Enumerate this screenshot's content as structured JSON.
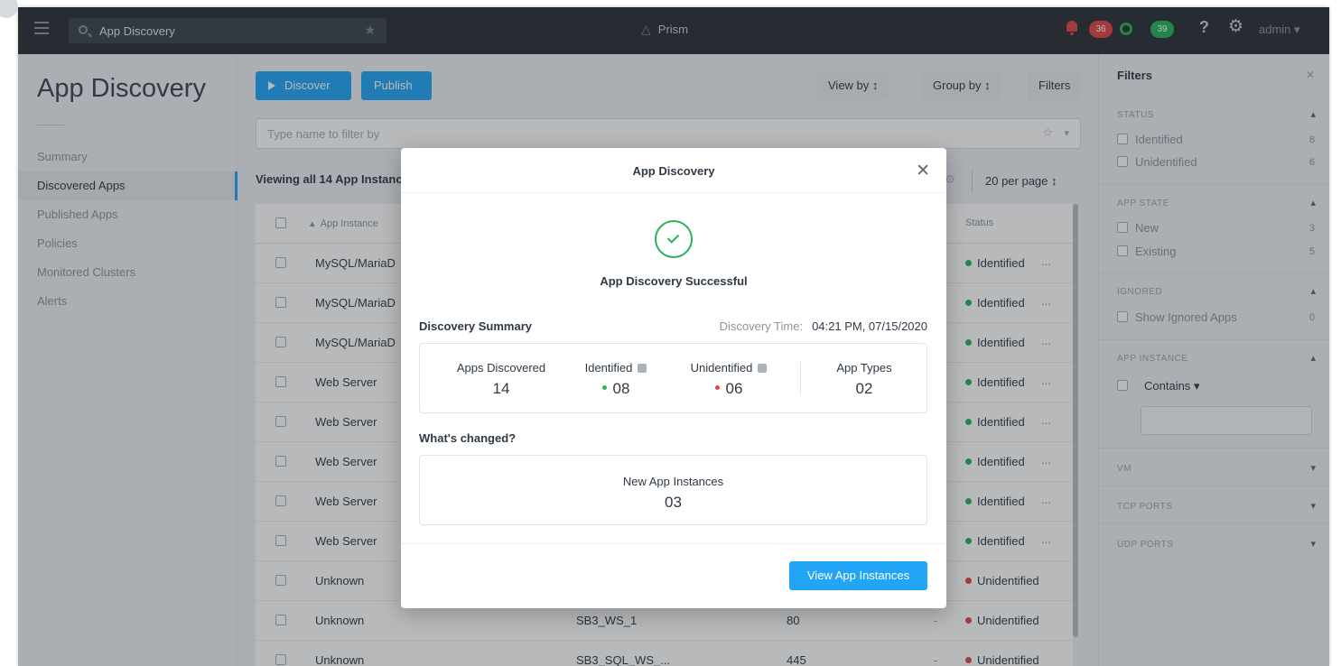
{
  "topbar": {
    "search_text": "App Discovery",
    "brand": "Prism",
    "alerts_count": "36",
    "tasks_count": "39",
    "help_label": "?",
    "user": "admin"
  },
  "leftnav": {
    "title": "App Discovery",
    "items": [
      "Summary",
      "Discovered Apps",
      "Published Apps",
      "Policies",
      "Monitored Clusters",
      "Alerts"
    ]
  },
  "toolbar": {
    "discover_label": "Discover",
    "publish_label": "Publish",
    "view_by": "View by",
    "group_by": "Group by",
    "filters": "Filters",
    "filter_placeholder": "Type name to filter by",
    "viewing": "Viewing all 14 App Instanc",
    "per_page": "20 per page"
  },
  "table": {
    "headers": {
      "app_instance": "App Instance",
      "status": "Status"
    },
    "rows": [
      {
        "name": "MySQL/MariaD",
        "vm": "",
        "port": "",
        "dash": "",
        "status": "Identified",
        "more": "..."
      },
      {
        "name": "MySQL/MariaD",
        "vm": "",
        "port": "",
        "dash": "",
        "status": "Identified",
        "more": "..."
      },
      {
        "name": "MySQL/MariaD",
        "vm": "",
        "port": "",
        "dash": "",
        "status": "Identified",
        "more": "..."
      },
      {
        "name": "Web Server",
        "vm": "",
        "port": "",
        "dash": "",
        "status": "Identified",
        "more": "..."
      },
      {
        "name": "Web Server",
        "vm": "",
        "port": "",
        "dash": "",
        "status": "Identified",
        "more": "..."
      },
      {
        "name": "Web Server",
        "vm": "",
        "port": "",
        "dash": "",
        "status": "Identified",
        "more": "..."
      },
      {
        "name": "Web Server",
        "vm": "",
        "port": "",
        "dash": "",
        "status": "Identified",
        "more": "..."
      },
      {
        "name": "Web Server",
        "vm": "",
        "port": "",
        "dash": "",
        "status": "Identified",
        "more": "..."
      },
      {
        "name": "Unknown",
        "vm": "",
        "port": "",
        "dash": "",
        "status": "Unidentified",
        "more": ""
      },
      {
        "name": "Unknown",
        "vm": "SB3_WS_1",
        "port": "80",
        "dash": "-",
        "status": "Unidentified",
        "more": ""
      },
      {
        "name": "Unknown",
        "vm": "SB3_SQL_WS_...",
        "port": "445",
        "dash": "-",
        "status": "Unidentified",
        "more": ""
      }
    ]
  },
  "filters": {
    "title": "Filters",
    "status_label": "STATUS",
    "identified_label": "Identified",
    "identified_count": "8",
    "unidentified_label": "Unidentified",
    "unidentified_count": "6",
    "app_state_label": "APP STATE",
    "new_label": "New",
    "new_count": "3",
    "existing_label": "Existing",
    "existing_count": "5",
    "ignored_label": "IGNORED",
    "show_ignored_label": "Show Ignored Apps",
    "show_ignored_count": "0",
    "app_instance_label": "APP INSTANCE",
    "contains_label": "Contains",
    "vm_label": "VM",
    "tcp_label": "TCP PORTS",
    "udp_label": "UDP PORTS"
  },
  "modal": {
    "title": "App Discovery",
    "success_message": "App Discovery Successful",
    "summary_label": "Discovery Summary",
    "time_label": "Discovery Time:",
    "time_value": "04:21 PM, 07/15/2020",
    "apps_discovered_label": "Apps Discovered",
    "apps_discovered_value": "14",
    "identified_label": "Identified",
    "identified_value": "08",
    "unidentified_label": "Unidentified",
    "unidentified_value": "06",
    "app_types_label": "App Types",
    "app_types_value": "02",
    "changed_label": "What's changed?",
    "new_instances_label": "New App Instances",
    "new_instances_value": "03",
    "view_button": "View App Instances"
  },
  "colors": {
    "accent": "#22a5f7",
    "success": "#29b45a",
    "danger": "#e24646",
    "topbar": "#2b3036"
  }
}
